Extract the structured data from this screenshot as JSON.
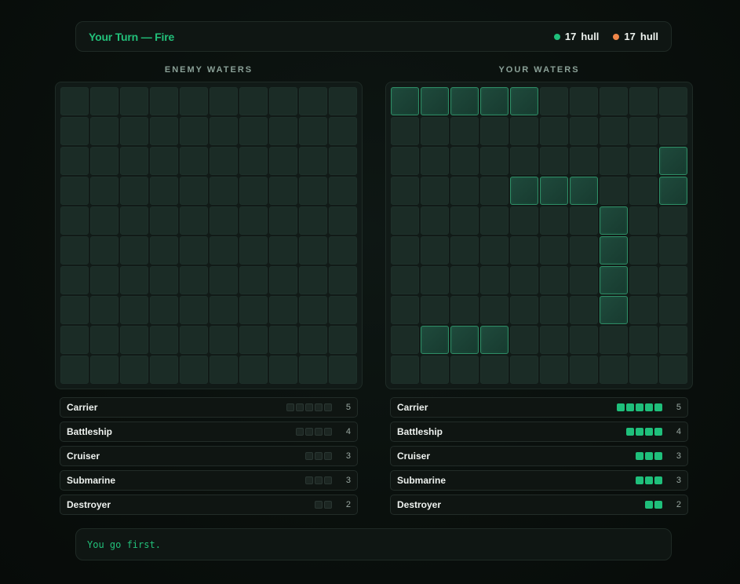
{
  "status": {
    "turn_title": "Your Turn — Fire",
    "player_hull": {
      "value": "17",
      "label": "hull",
      "color": "#1fbf7b"
    },
    "enemy_hull": {
      "value": "17",
      "label": "hull",
      "color": "#f0874a"
    }
  },
  "enemy_board": {
    "title": "ENEMY WATERS",
    "size": 10,
    "ship_cells": []
  },
  "player_board": {
    "title": "YOUR WATERS",
    "size": 10,
    "ship_cells": [
      [
        0,
        0
      ],
      [
        0,
        1
      ],
      [
        0,
        2
      ],
      [
        0,
        3
      ],
      [
        0,
        4
      ],
      [
        2,
        9
      ],
      [
        3,
        9
      ],
      [
        3,
        4
      ],
      [
        3,
        5
      ],
      [
        3,
        6
      ],
      [
        4,
        7
      ],
      [
        5,
        7
      ],
      [
        6,
        7
      ],
      [
        7,
        7
      ],
      [
        8,
        1
      ],
      [
        8,
        2
      ],
      [
        8,
        3
      ]
    ]
  },
  "enemy_fleet": [
    {
      "name": "Carrier",
      "size": 5,
      "alive": 0
    },
    {
      "name": "Battleship",
      "size": 4,
      "alive": 0
    },
    {
      "name": "Cruiser",
      "size": 3,
      "alive": 0
    },
    {
      "name": "Submarine",
      "size": 3,
      "alive": 0
    },
    {
      "name": "Destroyer",
      "size": 2,
      "alive": 0
    }
  ],
  "player_fleet": [
    {
      "name": "Carrier",
      "size": 5,
      "alive": 5
    },
    {
      "name": "Battleship",
      "size": 4,
      "alive": 4
    },
    {
      "name": "Cruiser",
      "size": 3,
      "alive": 3
    },
    {
      "name": "Submarine",
      "size": 3,
      "alive": 3
    },
    {
      "name": "Destroyer",
      "size": 2,
      "alive": 2
    }
  ],
  "log": {
    "message": "You go first."
  }
}
